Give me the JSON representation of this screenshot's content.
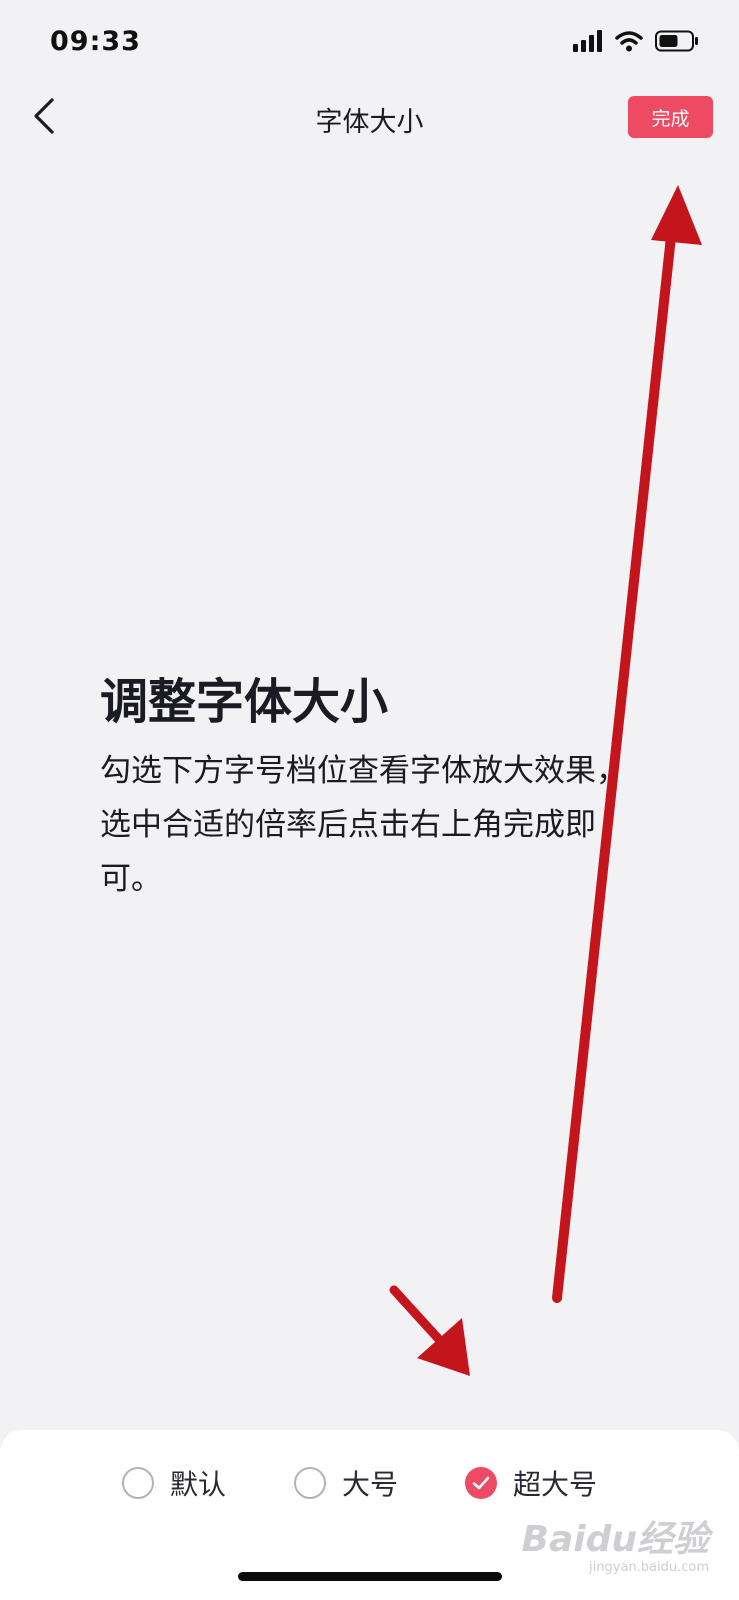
{
  "status_bar": {
    "time": "09:33",
    "icons": [
      "cellular-signal-icon",
      "wifi-icon",
      "battery-icon"
    ]
  },
  "nav": {
    "back_icon": "chevron-left-icon",
    "title": "字体大小",
    "done_label": "完成"
  },
  "intro": {
    "title": "调整字体大小",
    "description": "勾选下方字号档位查看字体放大效果，选中合适的倍率后点击右上角完成即可。"
  },
  "font_options": {
    "selected": "超大号",
    "items": [
      {
        "label": "默认",
        "checked": false
      },
      {
        "label": "大号",
        "checked": false
      },
      {
        "label": "超大号",
        "checked": true
      }
    ]
  },
  "watermark": {
    "brand": "Baidu经验",
    "url": "jingyan.baidu.com"
  },
  "colors": {
    "accent": "#ee4a63",
    "background": "#f2f1f3",
    "panel": "#ffffff",
    "annotation_arrow": "#c4151c"
  }
}
